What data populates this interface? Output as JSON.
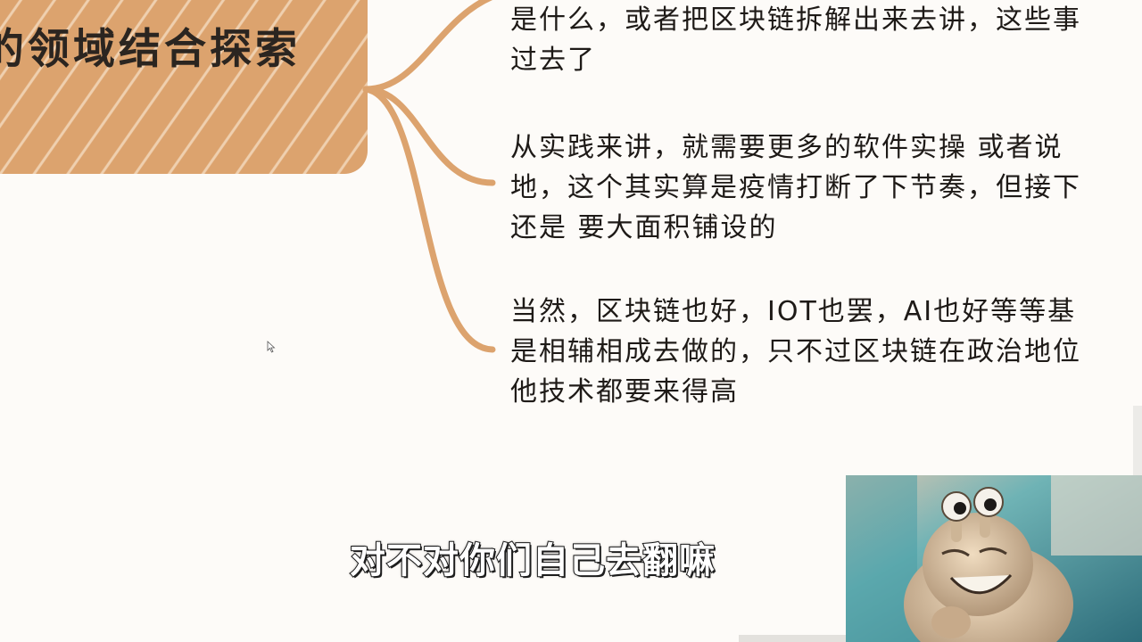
{
  "topic": {
    "title": "的领域结合探索"
  },
  "branches": [
    {
      "lines": [
        "是什么，或者把区块链拆解出来去讲，这些事",
        "过去了"
      ]
    },
    {
      "lines": [
        "从实践来讲，就需要更多的软件实操 或者说",
        "地，这个其实算是疫情打断了下节奏，但接下",
        "还是 要大面积铺设的"
      ]
    },
    {
      "lines": [
        "当然，区块链也好，IOT也罢，AI也好等等基",
        "是相辅相成去做的，只不过区块链在政治地位",
        "他技术都要来得高"
      ]
    }
  ],
  "subtitle": "对不对你们自己去翻嘛",
  "colors": {
    "node_fill": "#dca36e",
    "connector": "#dca36e",
    "text": "#1e1a17",
    "background": "#fdfbf8"
  },
  "icons": {
    "cursor": "mouse-pointer-icon"
  }
}
